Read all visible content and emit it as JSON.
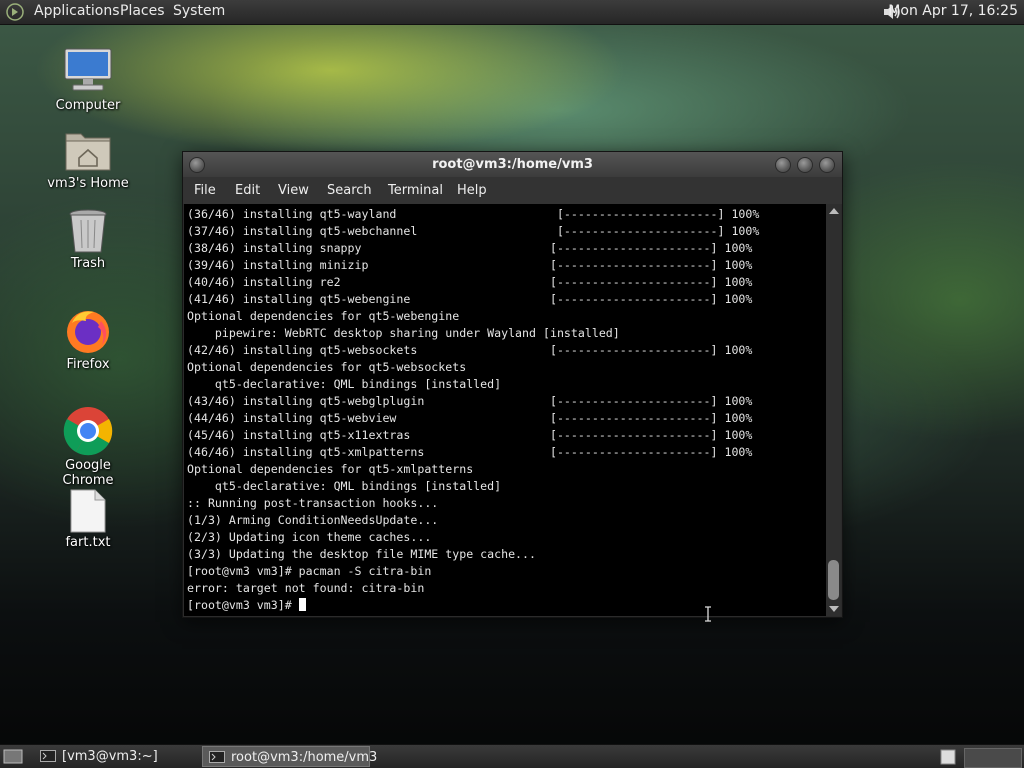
{
  "top_panel": {
    "menus": [
      "Applications",
      "Places",
      "System"
    ],
    "clock": "Mon Apr 17, 16:25",
    "icons": [
      "gnome-foot-logo",
      "volume-icon"
    ]
  },
  "desktop": {
    "icons": [
      {
        "label": "Computer",
        "icon": "computer-icon"
      },
      {
        "label": "vm3's Home",
        "icon": "home-folder-icon"
      },
      {
        "label": "Trash",
        "icon": "trash-icon"
      },
      {
        "label": "Firefox",
        "icon": "firefox-icon"
      },
      {
        "label": "Google Chrome",
        "icon": "chrome-icon"
      },
      {
        "label": "fart.txt",
        "icon": "text-file-icon"
      }
    ]
  },
  "terminal": {
    "title": "root@vm3:/home/vm3",
    "menu": [
      "File",
      "Edit",
      "View",
      "Search",
      "Terminal",
      "Help"
    ],
    "lines": [
      "(36/46) installing qt5-wayland                       [----------------------] 100%",
      "(37/46) installing qt5-webchannel                    [----------------------] 100%",
      "(38/46) installing snappy                           [----------------------] 100%",
      "(39/46) installing minizip                          [----------------------] 100%",
      "(40/46) installing re2                              [----------------------] 100%",
      "(41/46) installing qt5-webengine                    [----------------------] 100%",
      "Optional dependencies for qt5-webengine",
      "    pipewire: WebRTC desktop sharing under Wayland [installed]",
      "(42/46) installing qt5-websockets                   [----------------------] 100%",
      "Optional dependencies for qt5-websockets",
      "    qt5-declarative: QML bindings [installed]",
      "(43/46) installing qt5-webglplugin                  [----------------------] 100%",
      "(44/46) installing qt5-webview                      [----------------------] 100%",
      "(45/46) installing qt5-x11extras                    [----------------------] 100%",
      "(46/46) installing qt5-xmlpatterns                  [----------------------] 100%",
      "Optional dependencies for qt5-xmlpatterns",
      "    qt5-declarative: QML bindings [installed]",
      ":: Running post-transaction hooks...",
      "(1/3) Arming ConditionNeedsUpdate...",
      "(2/3) Updating icon theme caches...",
      "(3/3) Updating the desktop file MIME type cache...",
      "[root@vm3 vm3]# pacman -S citra-bin",
      "error: target not found: citra-bin"
    ],
    "prompt": "[root@vm3 vm3]# "
  },
  "taskbar": {
    "tasks": [
      {
        "label": "[vm3@vm3:~]",
        "active": false
      },
      {
        "label": "root@vm3:/home/vm3",
        "active": true
      }
    ]
  },
  "colors": {
    "panel": "#2e2e2e",
    "terminal_bg": "#000000",
    "terminal_fg": "#e5e5e5"
  }
}
